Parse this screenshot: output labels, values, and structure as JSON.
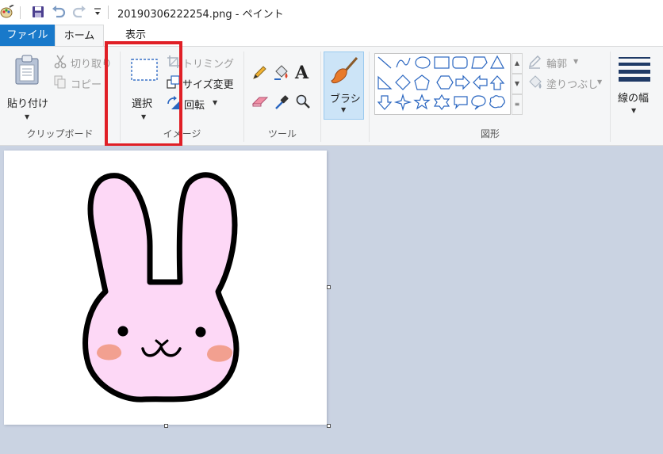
{
  "window": {
    "title": "20190306222254.png - ペイント"
  },
  "tabs": {
    "file": "ファイル",
    "home": "ホーム",
    "view": "表示"
  },
  "ribbon": {
    "clipboard": {
      "paste": "貼り付け",
      "cut": "切り取り",
      "copy": "コピー",
      "group_label": "クリップボード"
    },
    "image": {
      "select": "選択",
      "crop": "トリミング",
      "resize": "サイズ変更",
      "rotate": "回転",
      "group_label": "イメージ"
    },
    "tools": {
      "group_label": "ツール",
      "text_glyph": "A"
    },
    "brush": {
      "label": "ブラシ"
    },
    "shapes": {
      "outline": "輪郭",
      "fill": "塗りつぶし",
      "group_label": "図形"
    },
    "size": {
      "label": "線の幅"
    }
  },
  "colors": {
    "accent": "#1979ca",
    "highlight": "#e01f26",
    "workspace": "#cad3e2",
    "bunny_fill": "#fdd8f6",
    "cheek": "#f2a090"
  }
}
